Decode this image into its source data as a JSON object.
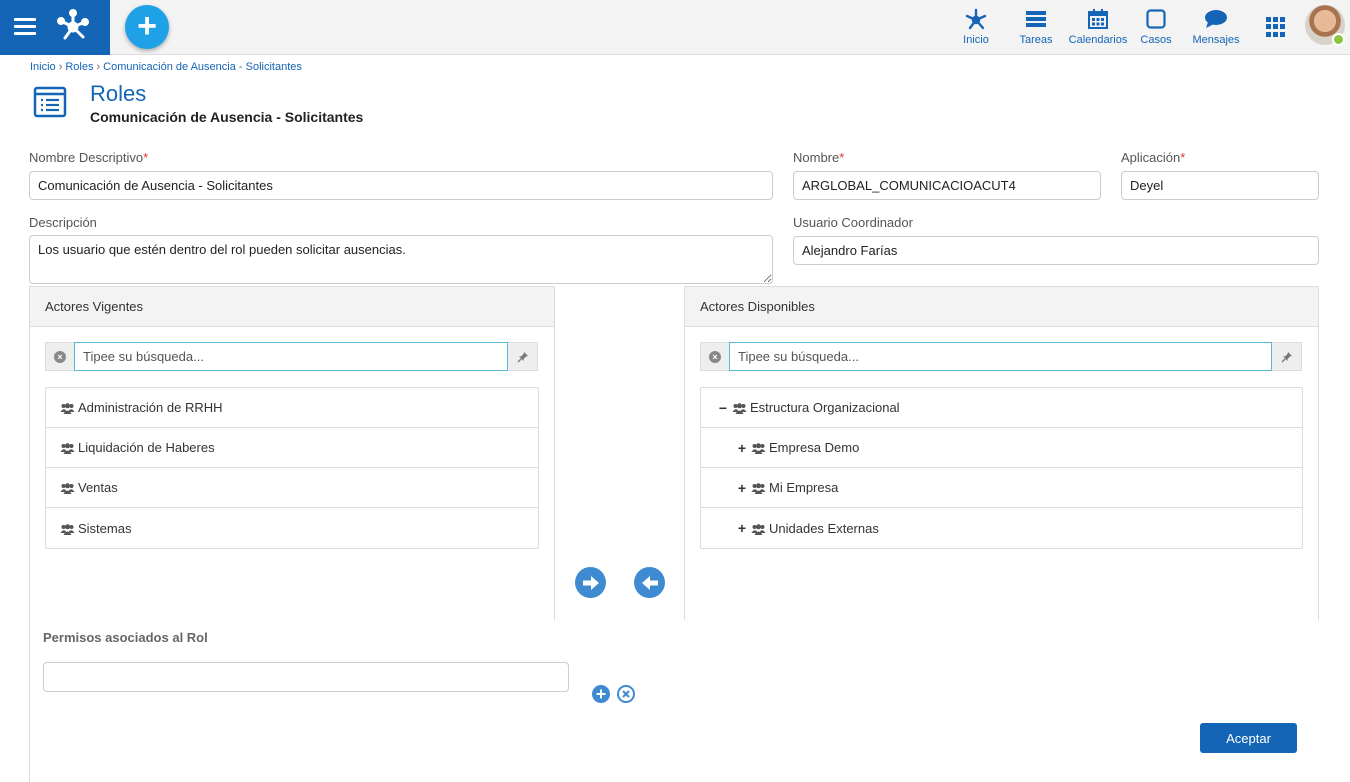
{
  "topbar": {
    "nav": [
      {
        "label": "Inicio",
        "icon": "network-icon"
      },
      {
        "label": "Tareas",
        "icon": "tasks-icon"
      },
      {
        "label": "Calendarios",
        "icon": "calendar-icon"
      },
      {
        "label": "Casos",
        "icon": "cases-icon"
      },
      {
        "label": "Mensajes",
        "icon": "messages-icon"
      }
    ],
    "brand_color": "#1565b7",
    "fab_label": "+"
  },
  "breadcrumb": [
    "Inicio",
    "Roles",
    "Comunicación de Ausencia - Solicitantes"
  ],
  "page": {
    "title": "Roles",
    "subtitle": "Comunicación de Ausencia - Solicitantes"
  },
  "form": {
    "nombre_descriptivo": {
      "label": "Nombre Descriptivo",
      "value": "Comunicación de Ausencia - Solicitantes"
    },
    "nombre": {
      "label": "Nombre",
      "value": "ARGLOBAL_COMUNICACIOACUT4"
    },
    "aplicacion": {
      "label": "Aplicación",
      "value": "Deyel"
    },
    "descripcion": {
      "label": "Descripción",
      "value": "Los usuario que estén dentro del rol pueden solicitar ausencias."
    },
    "usuario_coordinador": {
      "label": "Usuario Coordinador",
      "value": "Alejandro Farías"
    },
    "required_mark": "*"
  },
  "actores_vigentes": {
    "title": "Actores Vigentes",
    "search_placeholder": "Tipee su búsqueda...",
    "items": [
      "Administración de RRHH",
      "Liquidación de Haberes",
      "Ventas",
      "Sistemas"
    ]
  },
  "actores_disponibles": {
    "title": "Actores Disponibles",
    "search_placeholder": "Tipee su búsqueda...",
    "tree": [
      {
        "label": "Estructura Organizacional",
        "toggle": "−"
      },
      {
        "label": "Empresa Demo",
        "toggle": "+"
      },
      {
        "label": "Mi Empresa",
        "toggle": "+"
      },
      {
        "label": "Unidades Externas",
        "toggle": "+"
      }
    ]
  },
  "permisos": {
    "title": "Permisos asociados al Rol"
  },
  "actions": {
    "accept_label": "Aceptar"
  }
}
